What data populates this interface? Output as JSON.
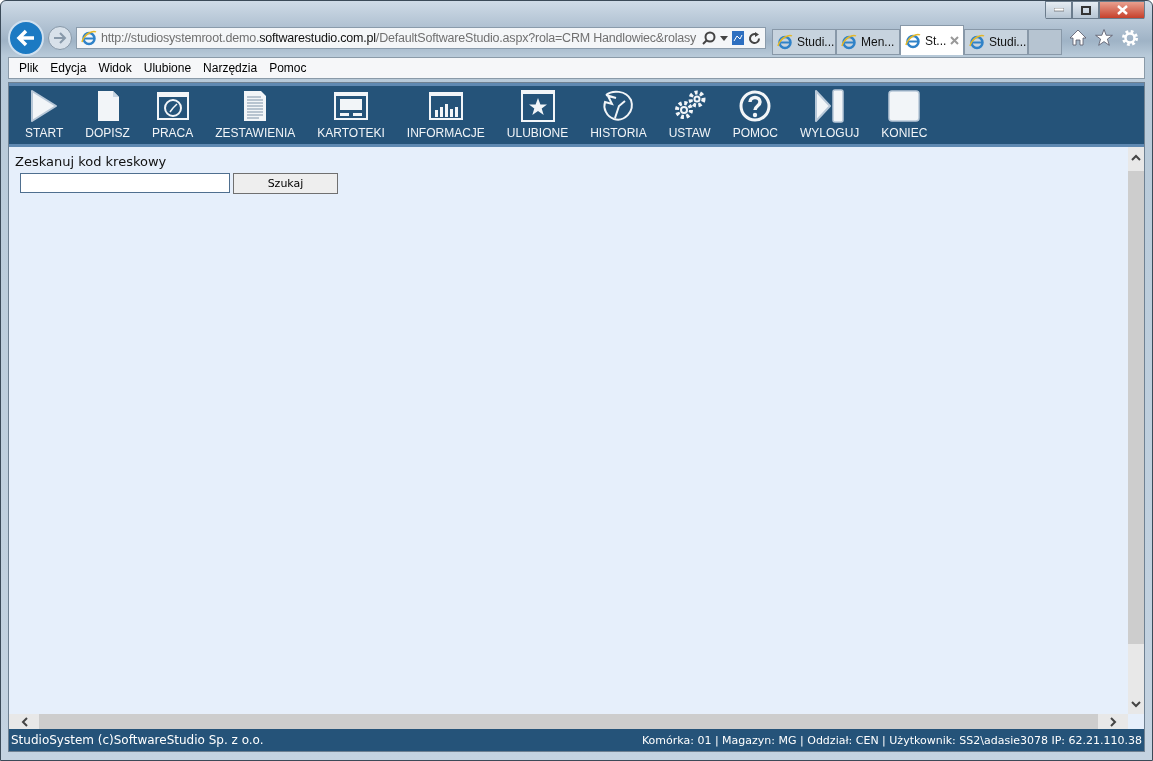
{
  "browser": {
    "address": "http://studiosystemroot.demo.**softwarestudio.com.pl**/DefaultSoftwareStudio.aspx?rola=CRM Handlowiec&rolasy",
    "tabs": [
      {
        "label": "Studi...",
        "selected": false
      },
      {
        "label": "Men...",
        "selected": false
      },
      {
        "label": "St...",
        "selected": true
      },
      {
        "label": "Studi...",
        "selected": false
      }
    ],
    "menu": [
      "Plik",
      "Edycja",
      "Widok",
      "Ulubione",
      "Narzędzia",
      "Pomoc"
    ]
  },
  "toolbar": [
    "START",
    "DOPISZ",
    "PRACA",
    "ZESTAWIENIA",
    "KARTOTEKI",
    "INFORMACJE",
    "ULUBIONE",
    "HISTORIA",
    "USTAW",
    "POMOC",
    "WYLOGUJ",
    "KONIEC"
  ],
  "scan": {
    "label": "Zeskanuj kod kreskowy",
    "button": "Szukaj"
  },
  "status_bar": {
    "left": "StudioSystem (c)SoftwareStudio Sp. z o.o.",
    "right": "Komórka: 01 | Magazyn: MG | Oddział: CEN | Użytkownik: SS2\\adasie3078 IP: 62.21.110.38"
  }
}
